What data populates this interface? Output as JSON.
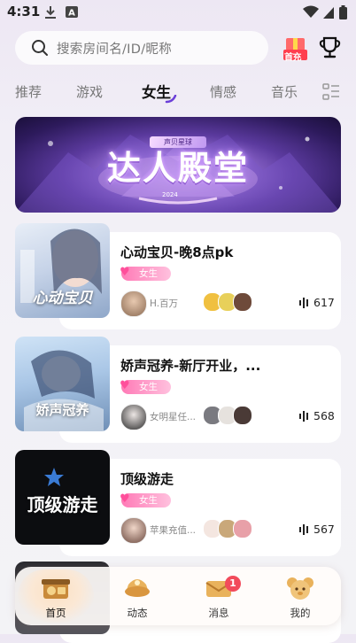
{
  "status_bar": {
    "time": "4:31"
  },
  "search": {
    "placeholder": "搜索房间名/ID/昵称"
  },
  "top_icons": {
    "first_charge_label": "首充"
  },
  "tabs": [
    {
      "label": "推荐",
      "active": false
    },
    {
      "label": "游戏",
      "active": false
    },
    {
      "label": "女生",
      "active": true
    },
    {
      "label": "情感",
      "active": false
    },
    {
      "label": "音乐",
      "active": false
    }
  ],
  "banner": {
    "badge": "声贝星球",
    "title": "达人殿堂",
    "year": "2024"
  },
  "rooms": [
    {
      "title": "心动宝贝-晚8点pk",
      "tag": "女生",
      "host": "H.百万",
      "count": "617",
      "cover_text": "心动宝贝"
    },
    {
      "title": "娇声冠养-新厅开业，...",
      "tag": "女生",
      "host": "女明星任...",
      "count": "568",
      "cover_text": "娇声冠养"
    },
    {
      "title": "顶级游走",
      "tag": "女生",
      "host": "苹果充值...",
      "count": "567",
      "cover_text": "顶级游走"
    }
  ],
  "bottom_nav": [
    {
      "label": "首页",
      "icon": "home-icon",
      "active": true
    },
    {
      "label": "动态",
      "icon": "moments-icon",
      "active": false
    },
    {
      "label": "消息",
      "icon": "message-icon",
      "active": false,
      "badge": "1"
    },
    {
      "label": "我的",
      "icon": "profile-icon",
      "active": false
    }
  ],
  "colors": {
    "accent": "#6b3fd8",
    "tag_pink": "#ff7ab6",
    "badge_red": "#f24b5b"
  }
}
